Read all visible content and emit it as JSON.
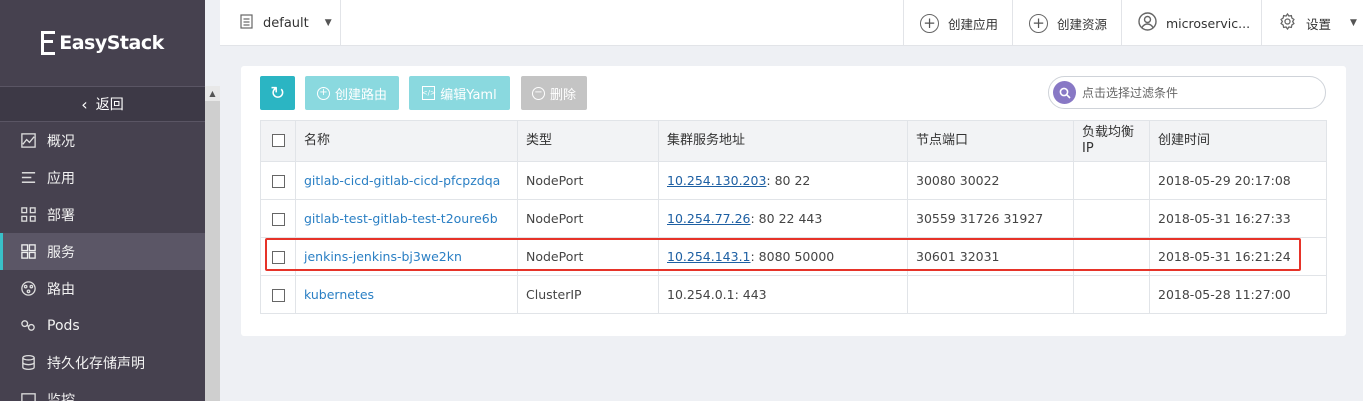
{
  "sidebar": {
    "logo": "EasyStack",
    "back_label": "返回",
    "items": [
      {
        "label": "概况",
        "icon": "chart-icon"
      },
      {
        "label": "应用",
        "icon": "list-icon"
      },
      {
        "label": "部署",
        "icon": "deploy-icon"
      },
      {
        "label": "服务",
        "icon": "services-icon",
        "active": true
      },
      {
        "label": "路由",
        "icon": "route-icon"
      },
      {
        "label": "Pods",
        "icon": "pods-icon"
      },
      {
        "label": "持久化存储声明",
        "icon": "storage-icon"
      },
      {
        "label": "监控",
        "icon": "monitor-icon"
      }
    ]
  },
  "topbar": {
    "project": "default",
    "create_app": "创建应用",
    "create_resource": "创建资源",
    "user": "microservic...",
    "settings": "设置"
  },
  "toolbar": {
    "create_route": "创建路由",
    "edit_yaml": "编辑Yaml",
    "delete": "删除",
    "search_placeholder": "点击选择过滤条件"
  },
  "table": {
    "headers": {
      "name": "名称",
      "type": "类型",
      "cluster_address": "集群服务地址",
      "node_port": "节点端口",
      "lb_ip": "负载均衡IP",
      "created": "创建时间"
    },
    "rows": [
      {
        "name": "gitlab-cicd-gitlab-cicd-pfcpzdqa",
        "type": "NodePort",
        "ip": "10.254.130.203",
        "ports": ": 80 22",
        "node_ports": "30080 30022",
        "lb_ip": "",
        "created": "2018-05-29 20:17:08"
      },
      {
        "name": "gitlab-test-gitlab-test-t2oure6b",
        "type": "NodePort",
        "ip": "10.254.77.26",
        "ports": ": 80 22 443",
        "node_ports": "30559 31726 31927",
        "lb_ip": "",
        "created": "2018-05-31 16:27:33"
      },
      {
        "name": "jenkins-jenkins-bj3we2kn",
        "type": "NodePort",
        "ip": "10.254.143.1",
        "ports": ": 8080 50000",
        "node_ports": "30601 32031",
        "lb_ip": "",
        "created": "2018-05-31 16:21:24"
      },
      {
        "name": "kubernetes",
        "type": "ClusterIP",
        "ip": "10.254.0.1",
        "ports": ": 443",
        "node_ports": "",
        "lb_ip": "",
        "created": "2018-05-28 11:27:00"
      }
    ]
  },
  "colors": {
    "sidebar_bg": "#46414f",
    "accent": "#2bb5c3",
    "highlight_border": "#e63329",
    "link": "#2a7fc4"
  }
}
